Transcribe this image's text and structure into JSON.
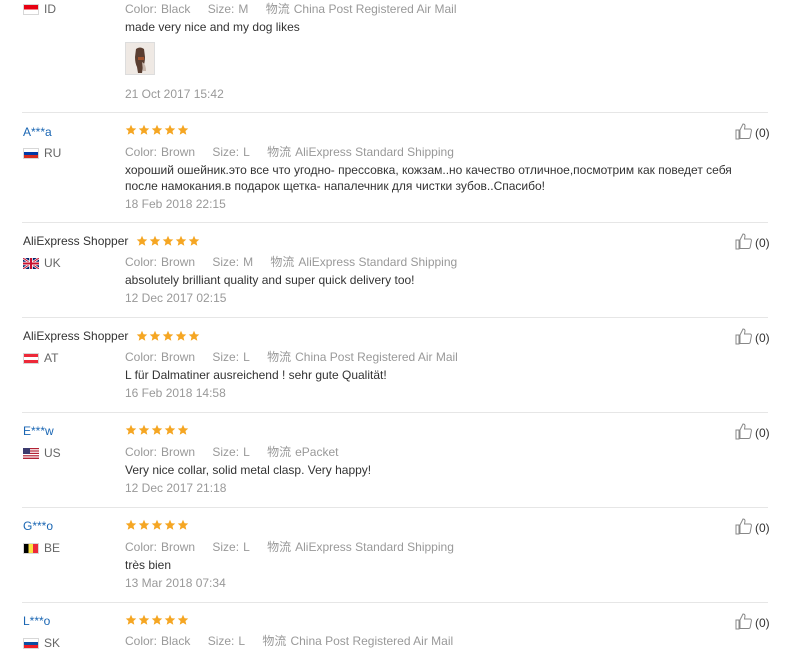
{
  "reviews": [
    {
      "id": "r0",
      "country_code": "ID",
      "color_label": "Color:",
      "color": "Black",
      "size_label": "Size:",
      "size": "M",
      "ship_label": "物流",
      "shipping": "China Post Registered Air Mail",
      "text": "made very nice and my dog likes",
      "date": "21 Oct 2017 15:42",
      "has_photo": true
    },
    {
      "id": "r1",
      "name": "A***a",
      "country_code": "RU",
      "rating": 5,
      "color_label": "Color:",
      "color": "Brown",
      "size_label": "Size:",
      "size": "L",
      "ship_label": "物流",
      "shipping": "AliExpress Standard Shipping",
      "text": "хороший ошейник.это все что угодно- прессовка, кожзам..но качество отличное,посмотрим как поведет себя после намокания.в подарок щетка- напалечник для чистки зубов..Спасибо!",
      "date": "18 Feb 2018 22:15",
      "helpful": "(0)"
    },
    {
      "id": "r2",
      "name": "AliExpress Shopper",
      "country_code": "UK",
      "rating": 5,
      "color_label": "Color:",
      "color": "Brown",
      "size_label": "Size:",
      "size": "M",
      "ship_label": "物流",
      "shipping": "AliExpress Standard Shipping",
      "text": "absolutely brilliant quality and super quick delivery too!",
      "date": "12 Dec 2017 02:15",
      "helpful": "(0)"
    },
    {
      "id": "r3",
      "name": "AliExpress Shopper",
      "country_code": "AT",
      "rating": 5,
      "color_label": "Color:",
      "color": "Brown",
      "size_label": "Size:",
      "size": "L",
      "ship_label": "物流",
      "shipping": "China Post Registered Air Mail",
      "text": "L für Dalmatiner ausreichend ! sehr gute Qualität!",
      "date": "16 Feb 2018 14:58",
      "helpful": "(0)"
    },
    {
      "id": "r4",
      "name": "E***w",
      "country_code": "US",
      "rating": 5,
      "color_label": "Color:",
      "color": "Brown",
      "size_label": "Size:",
      "size": "L",
      "ship_label": "物流",
      "shipping": "ePacket",
      "text": "Very nice collar, solid metal clasp. Very happy!",
      "date": "12 Dec 2017 21:18",
      "helpful": "(0)"
    },
    {
      "id": "r5",
      "name": "G***o",
      "country_code": "BE",
      "rating": 5,
      "color_label": "Color:",
      "color": "Brown",
      "size_label": "Size:",
      "size": "L",
      "ship_label": "物流",
      "shipping": "AliExpress Standard Shipping",
      "text": "très bien",
      "date": "13 Mar 2018 07:34",
      "helpful": "(0)"
    },
    {
      "id": "r6",
      "name": "L***o",
      "country_code": "SK",
      "rating": 5,
      "color_label": "Color:",
      "color": "Black",
      "size_label": "Size:",
      "size": "L",
      "ship_label": "物流",
      "shipping": "China Post Registered Air Mail",
      "helpful": "(0)"
    }
  ],
  "colors": {
    "star": "#f5a623",
    "link": "#1a66b3",
    "muted": "#999999"
  },
  "icons": {
    "star": "star-icon",
    "helpful": "thumbs-up-icon"
  }
}
